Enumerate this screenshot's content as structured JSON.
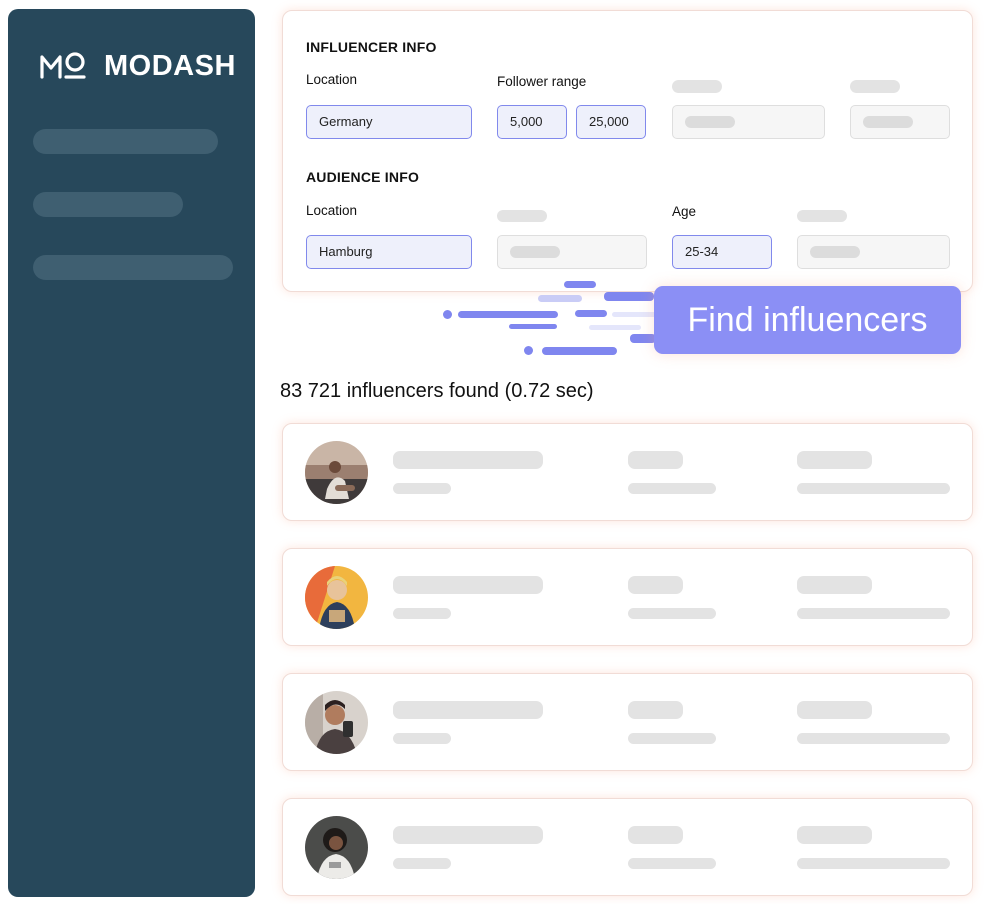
{
  "brand": {
    "name": "MODASH",
    "logo_icon": "modash-mo-logo"
  },
  "filters": {
    "influencer_info": {
      "title": "INFLUENCER INFO",
      "location_label": "Location",
      "location_value": "Germany",
      "follower_range_label": "Follower range",
      "follower_min": "5,000",
      "follower_max": "25,000"
    },
    "audience_info": {
      "title": "AUDIENCE INFO",
      "location_label": "Location",
      "location_value": "Hamburg",
      "age_label": "Age",
      "age_value": "25-34"
    }
  },
  "cta": {
    "label": "Find influencers"
  },
  "results": {
    "summary": "83 721 influencers found (0.72 sec)",
    "rows": [
      {
        "avatar": "beach-portrait"
      },
      {
        "avatar": "yellow-background-portrait"
      },
      {
        "avatar": "selfie-portrait"
      },
      {
        "avatar": "dark-background-portrait"
      }
    ]
  },
  "colors": {
    "sidebar": "#27485b",
    "accent": "#8b8ff5",
    "input_active_bg": "#eef0fb",
    "skeleton": "#e3e3e3"
  }
}
